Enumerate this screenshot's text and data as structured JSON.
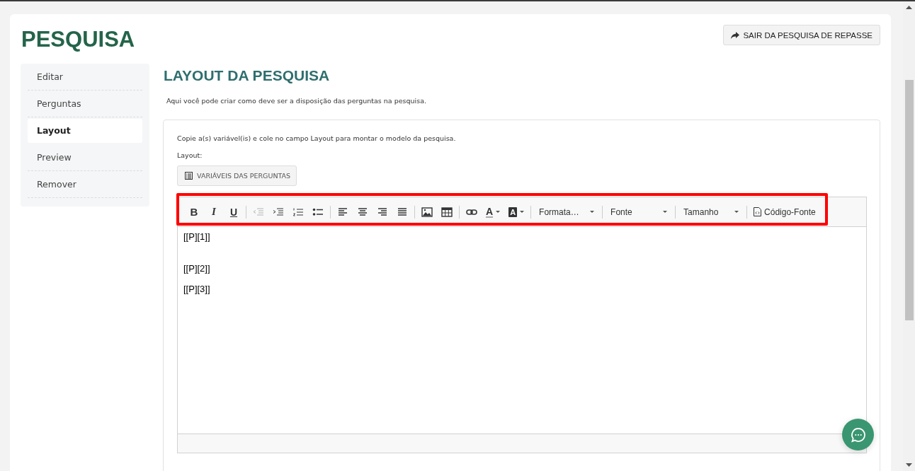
{
  "page": {
    "title": "PESQUISA",
    "exit_button": "SAIR DA PESQUISA DE REPASSE"
  },
  "sidebar": {
    "items": [
      {
        "label": "Editar",
        "selected": false
      },
      {
        "label": "Perguntas",
        "selected": false
      },
      {
        "label": "Layout",
        "selected": true
      },
      {
        "label": "Preview",
        "selected": false
      },
      {
        "label": "Remover",
        "selected": false
      }
    ]
  },
  "section": {
    "title": "LAYOUT DA PESQUISA",
    "description": "Aqui você pode criar como deve ser a disposição das perguntas na pesquisa.",
    "instruction": "Copie a(s) variável(is) e cole no campo Layout para montar o modelo da pesquisa.",
    "field_label": "Layout:",
    "variables_button": "VARIÁVEIS DAS PERGUNTAS"
  },
  "editor": {
    "highlighted": true,
    "toolbar": [
      [
        {
          "kind": "bold",
          "label": "B",
          "disabled": false
        },
        {
          "kind": "italic",
          "label": "I",
          "disabled": false
        },
        {
          "kind": "underline",
          "label": "U",
          "disabled": false
        }
      ],
      [
        {
          "kind": "outdent",
          "disabled": true
        },
        {
          "kind": "indent",
          "disabled": false
        },
        {
          "kind": "numbered",
          "disabled": false
        },
        {
          "kind": "bulleted",
          "disabled": false
        }
      ],
      [
        {
          "kind": "alignleft",
          "disabled": false
        },
        {
          "kind": "aligncenter",
          "disabled": false
        },
        {
          "kind": "alignright",
          "disabled": false
        },
        {
          "kind": "justify",
          "disabled": false
        }
      ],
      [
        {
          "kind": "image",
          "disabled": false
        },
        {
          "kind": "table",
          "disabled": false
        }
      ],
      [
        {
          "kind": "link",
          "disabled": false
        },
        {
          "kind": "textcolor",
          "label": "A",
          "disabled": false
        },
        {
          "kind": "bgcolor",
          "label": "A",
          "disabled": false
        }
      ],
      [
        {
          "kind": "dropdown",
          "label": "Formata…",
          "disabled": false
        }
      ],
      [
        {
          "kind": "dropdown",
          "label": "Fonte",
          "disabled": false
        }
      ],
      [
        {
          "kind": "dropdown",
          "label": "Tamanho",
          "disabled": false
        }
      ],
      [
        {
          "kind": "source",
          "label": "Código-Fonte",
          "disabled": false
        }
      ]
    ],
    "content": [
      {
        "kind": "text",
        "text": "[[P][1]]"
      },
      {
        "kind": "blank"
      },
      {
        "kind": "text",
        "text": "[[P][2]]"
      },
      {
        "kind": "text",
        "text": "[[P][3]]"
      }
    ]
  }
}
